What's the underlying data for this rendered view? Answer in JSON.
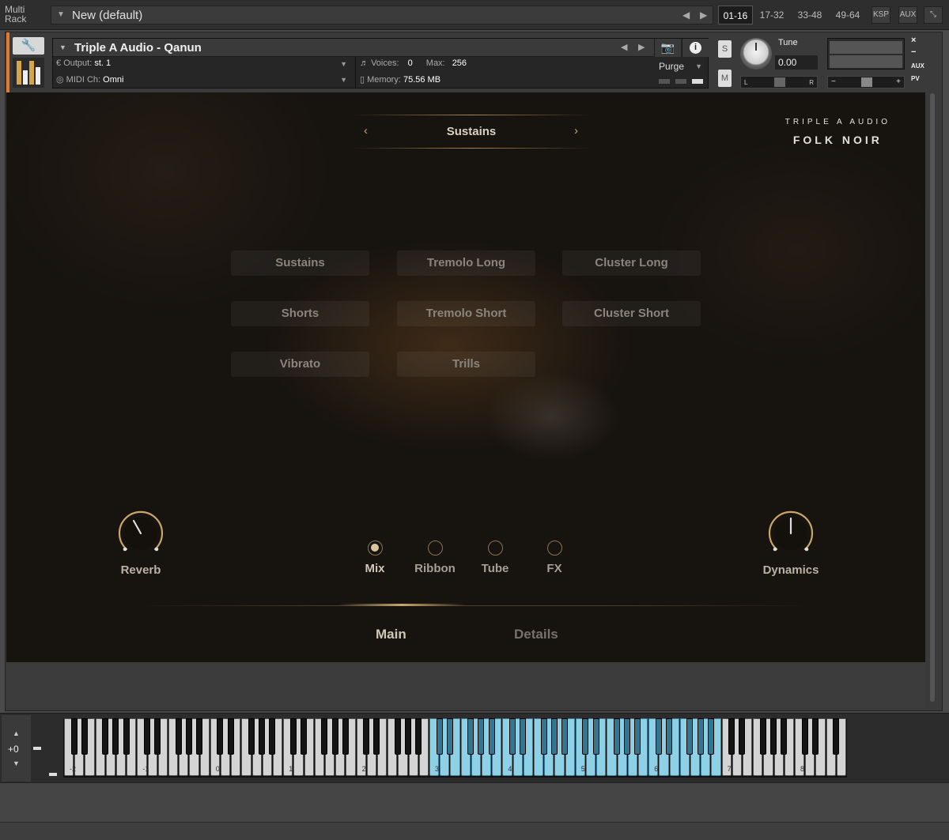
{
  "rack": {
    "label_line1": "Multi",
    "label_line2": "Rack",
    "preset": "New (default)",
    "bank_tabs": [
      "01-16",
      "17-32",
      "33-48",
      "49-64"
    ],
    "ksp": "KSP",
    "aux": "AUX"
  },
  "instrument": {
    "title": "Triple A Audio - Qanun",
    "output_label": "Output:",
    "output_value": "st. 1",
    "midi_label": "MIDI Ch:",
    "midi_value": "Omni",
    "voices_label": "Voices:",
    "voices_value": "0",
    "max_label": "Max:",
    "max_value": "256",
    "memory_label": "Memory:",
    "memory_value": "75.56 MB",
    "purge": "Purge",
    "solo": "S",
    "mute": "M",
    "tune_label": "Tune",
    "tune_value": "0.00",
    "pan_left": "L",
    "pan_right": "R",
    "vol_minus": "−",
    "vol_plus": "+",
    "aux": "AUX",
    "pv": "PV"
  },
  "gui": {
    "current_articulation": "Sustains",
    "brand_line1": "TRIPLE A AUDIO",
    "brand_line2": "FOLK NOIR",
    "articulations": [
      "Sustains",
      "Tremolo Long",
      "Cluster Long",
      "Shorts",
      "Tremolo Short",
      "Cluster Short",
      "Vibrato",
      "Trills"
    ],
    "reverb_label": "Reverb",
    "dynamics_label": "Dynamics",
    "mics": [
      "Mix",
      "Ribbon",
      "Tube",
      "FX"
    ],
    "selected_mic": "Mix",
    "tabs": [
      "Main",
      "Details"
    ],
    "active_tab": "Main",
    "accent_color": "#c9a66b"
  },
  "keyboard": {
    "transpose": "+0",
    "octave_labels": [
      "-2",
      "-1",
      "0",
      "1",
      "2",
      "3",
      "4",
      "5",
      "6",
      "7",
      "8"
    ],
    "highlight_color": "#8ed0e6"
  }
}
